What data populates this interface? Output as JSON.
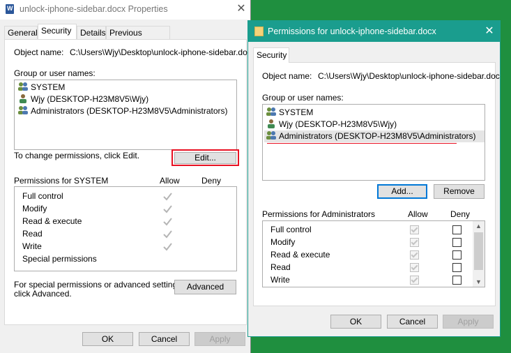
{
  "properties": {
    "title": "unlock-iphone-sidebar.docx Properties",
    "tabs": [
      "General",
      "Security",
      "Details",
      "Previous Versions"
    ],
    "object_label": "Object name:",
    "object_value": "C:\\Users\\Wjy\\Desktop\\unlock-iphone-sidebar.doc",
    "group_label": "Group or user names:",
    "users": [
      "SYSTEM",
      "Wjy (DESKTOP-H23M8V5\\Wjy)",
      "Administrators (DESKTOP-H23M8V5\\Administrators)"
    ],
    "change_text": "To change permissions, click Edit.",
    "edit_label": "Edit...",
    "perms_for": "Permissions for SYSTEM",
    "allow": "Allow",
    "deny": "Deny",
    "perms": [
      "Full control",
      "Modify",
      "Read & execute",
      "Read",
      "Write",
      "Special permissions"
    ],
    "special_line1": "For special permissions or advanced settings,",
    "special_line2": "click Advanced.",
    "advanced_label": "Advanced",
    "ok": "OK",
    "cancel": "Cancel",
    "apply": "Apply"
  },
  "permissions": {
    "title": "Permissions for unlock-iphone-sidebar.docx",
    "tab": "Security",
    "object_label": "Object name:",
    "object_value": "C:\\Users\\Wjy\\Desktop\\unlock-iphone-sidebar.doc",
    "group_label": "Group or user names:",
    "users": [
      "SYSTEM",
      "Wjy (DESKTOP-H23M8V5\\Wjy)",
      "Administrators (DESKTOP-H23M8V5\\Administrators)"
    ],
    "add_label": "Add...",
    "remove_label": "Remove",
    "perms_for": "Permissions for Administrators",
    "allow": "Allow",
    "deny": "Deny",
    "perms": [
      "Full control",
      "Modify",
      "Read & execute",
      "Read",
      "Write"
    ],
    "ok": "OK",
    "cancel": "Cancel",
    "apply": "Apply"
  },
  "colors": {
    "highlight_red": "#e81123",
    "focus_blue": "#0078d7",
    "selected_row": "#e5e5e5"
  },
  "icons": {
    "close": "close-icon",
    "user_group": "users-icon",
    "user": "user-icon",
    "document": "word-document-icon",
    "folder": "folder-icon"
  }
}
